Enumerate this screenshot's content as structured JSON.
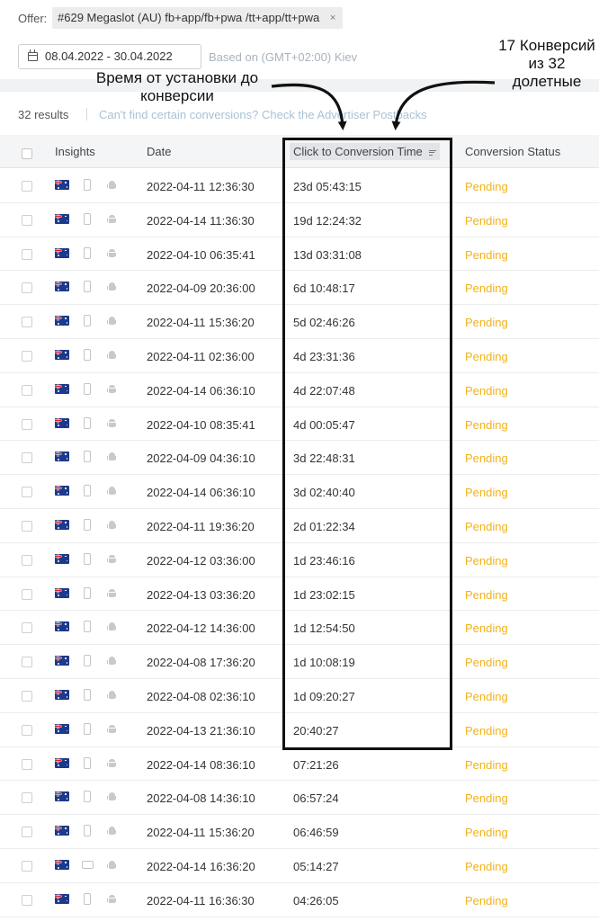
{
  "offer": {
    "label": "Offer:",
    "chip_text": "#629 Megaslot (AU) fb+app/fb+pwa /tt+app/tt+pwa",
    "chip_close": "×"
  },
  "filters": {
    "date_range": "08.04.2022 - 30.04.2022",
    "timezone_note": "Based on (GMT+02:00) Kiev"
  },
  "results": {
    "count": "32 results",
    "link": "Can't find certain conversions? Check the Advertiser Postbacks"
  },
  "table": {
    "headers": {
      "insights": "Insights",
      "date": "Date",
      "ctc": "Click to Conversion Time",
      "status": "Conversion Status"
    },
    "rows": [
      {
        "date": "2022-04-11 12:36:30",
        "ctc": "23d 05:43:15",
        "status": "Pending",
        "device": "phone"
      },
      {
        "date": "2022-04-14 11:36:30",
        "ctc": "19d 12:24:32",
        "status": "Pending",
        "device": "phone"
      },
      {
        "date": "2022-04-10 06:35:41",
        "ctc": "13d 03:31:08",
        "status": "Pending",
        "device": "phone"
      },
      {
        "date": "2022-04-09 20:36:00",
        "ctc": "6d 10:48:17",
        "status": "Pending",
        "device": "phone"
      },
      {
        "date": "2022-04-11 15:36:20",
        "ctc": "5d 02:46:26",
        "status": "Pending",
        "device": "phone"
      },
      {
        "date": "2022-04-11 02:36:00",
        "ctc": "4d 23:31:36",
        "status": "Pending",
        "device": "phone"
      },
      {
        "date": "2022-04-14 06:36:10",
        "ctc": "4d 22:07:48",
        "status": "Pending",
        "device": "phone"
      },
      {
        "date": "2022-04-10 08:35:41",
        "ctc": "4d 00:05:47",
        "status": "Pending",
        "device": "phone"
      },
      {
        "date": "2022-04-09 04:36:10",
        "ctc": "3d 22:48:31",
        "status": "Pending",
        "device": "phone"
      },
      {
        "date": "2022-04-14 06:36:10",
        "ctc": "3d 02:40:40",
        "status": "Pending",
        "device": "phone"
      },
      {
        "date": "2022-04-11 19:36:20",
        "ctc": "2d 01:22:34",
        "status": "Pending",
        "device": "phone"
      },
      {
        "date": "2022-04-12 03:36:00",
        "ctc": "1d 23:46:16",
        "status": "Pending",
        "device": "phone"
      },
      {
        "date": "2022-04-13 03:36:20",
        "ctc": "1d 23:02:15",
        "status": "Pending",
        "device": "phone"
      },
      {
        "date": "2022-04-12 14:36:00",
        "ctc": "1d 12:54:50",
        "status": "Pending",
        "device": "phone"
      },
      {
        "date": "2022-04-08 17:36:20",
        "ctc": "1d 10:08:19",
        "status": "Pending",
        "device": "phone"
      },
      {
        "date": "2022-04-08 02:36:10",
        "ctc": "1d 09:20:27",
        "status": "Pending",
        "device": "phone"
      },
      {
        "date": "2022-04-13 21:36:10",
        "ctc": "20:40:27",
        "status": "Pending",
        "device": "phone"
      },
      {
        "date": "2022-04-14 08:36:10",
        "ctc": "07:21:26",
        "status": "Pending",
        "device": "phone"
      },
      {
        "date": "2022-04-08 14:36:10",
        "ctc": "06:57:24",
        "status": "Pending",
        "device": "phone"
      },
      {
        "date": "2022-04-11 15:36:20",
        "ctc": "06:46:59",
        "status": "Pending",
        "device": "phone"
      },
      {
        "date": "2022-04-14 16:36:20",
        "ctc": "05:14:27",
        "status": "Pending",
        "device": "tablet"
      },
      {
        "date": "2022-04-11 16:36:30",
        "ctc": "04:26:05",
        "status": "Pending",
        "device": "phone"
      }
    ]
  },
  "annotations": {
    "left_text": "Время от установки до конверсии",
    "right_text": "17 Конверсий из 32 долетные"
  },
  "colors": {
    "status_pending": "#f2b21b",
    "link": "#a9c2d6",
    "highlight_border": "#111111"
  }
}
